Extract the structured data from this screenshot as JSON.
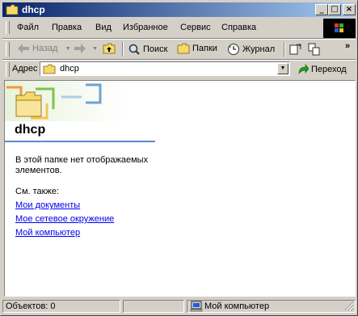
{
  "window": {
    "title": "dhcp"
  },
  "menubar": {
    "items": [
      {
        "label": "Файл"
      },
      {
        "label": "Правка"
      },
      {
        "label": "Вид"
      },
      {
        "label": "Избранное"
      },
      {
        "label": "Сервис"
      },
      {
        "label": "Справка"
      }
    ]
  },
  "toolbar": {
    "back_label": "Назад",
    "search_label": "Поиск",
    "folders_label": "Папки",
    "history_label": "Журнал",
    "overflow": "»"
  },
  "address": {
    "label": "Адрес",
    "value": "dhcp",
    "go_label": "Переход"
  },
  "content": {
    "folder_title": "dhcp",
    "empty_message": "В этой папке нет отображаемых элементов.",
    "see_also_label": "См. также:",
    "links": [
      {
        "label": "Мои документы"
      },
      {
        "label": "Мое сетевое окружение"
      },
      {
        "label": "Мой компьютер"
      }
    ]
  },
  "statusbar": {
    "objects": "Объектов: 0",
    "location": "Мой компьютер"
  },
  "colors": {
    "title_start": "#0a246a",
    "title_end": "#a6caf0",
    "link": "#0000ee",
    "rule": "#5b87d6"
  }
}
